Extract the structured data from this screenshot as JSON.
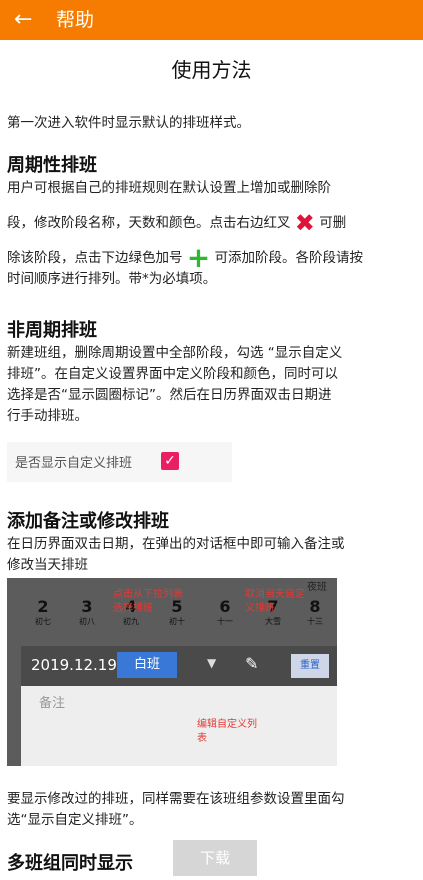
{
  "appbar": {
    "back_icon": "arrow-left-icon",
    "title": "帮助"
  },
  "page_title": "使用方法",
  "intro": "第一次进入软件时显示默认的排班样式。",
  "section1": {
    "heading": "周期性排班",
    "line1": "用户可根据自己的排班规则在默认设置上增加或删除阶",
    "line2a": "段，修改阶段名称，天数和颜色。点击右边红叉",
    "line2b": "可删",
    "line3a": "除该阶段，点击下边绿色加号",
    "line3b": "可添加阶段。各阶段请按",
    "line4": "时间顺序进行排列。带*为必填项。"
  },
  "section2": {
    "heading": "非周期排班",
    "line1": "新建班组，删除周期设置中全部阶段，勾选 “显示自定义",
    "line2": "排班”。在自定义设置界面中定义阶段和颜色，同时可以",
    "line3": "选择是否“显示圆圈标记”。然后在日历界面双击日期进",
    "line4": "行手动排班。",
    "checkbox_label": "是否显示自定义排班",
    "checkbox_checked": true
  },
  "section3": {
    "heading": "添加备注或修改排班",
    "line1": "在日历界面双击日期，在弹出的对话框中即可输入备注或",
    "line2": "修改当天排班",
    "screenshot": {
      "night_label": "夜班",
      "days": [
        {
          "n": "2",
          "l": "初七"
        },
        {
          "n": "3",
          "l": "初八"
        },
        {
          "n": "4",
          "l": "初九"
        },
        {
          "n": "5",
          "l": "初十"
        },
        {
          "n": "6",
          "l": "十一"
        },
        {
          "n": "7",
          "l": "大雪"
        },
        {
          "n": "8",
          "l": "十三"
        }
      ],
      "date": "2019.12.19",
      "shift": "白班",
      "reset": "重置",
      "note_placeholder": "备注",
      "ann_dropdown": "点击从下拉列表选择排班",
      "ann_reset": "取消当天自定义排班",
      "ann_edit": "编辑自定义列表"
    },
    "after1": "要显示修改过的排班，同样需要在该班组参数设置里面勾",
    "after2": "选“显示自定义排班”。"
  },
  "section4": {
    "heading": "多班组同时显示",
    "download": "下载"
  }
}
